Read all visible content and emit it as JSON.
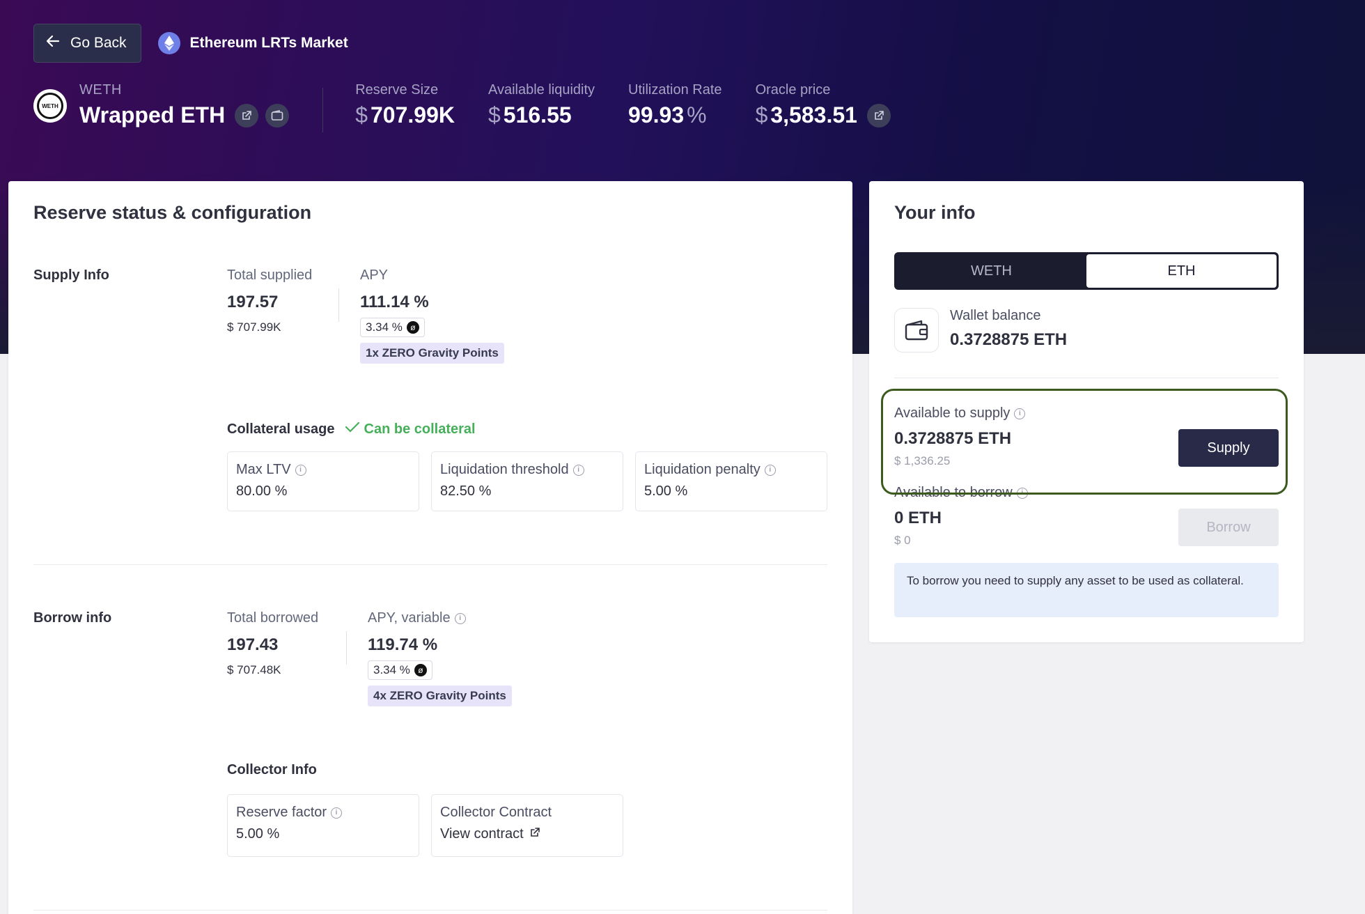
{
  "header": {
    "back_label": "Go Back",
    "market_name": "Ethereum LRTs Market",
    "asset_logo_text": "WETH",
    "asset_symbol": "WETH",
    "asset_name": "Wrapped ETH",
    "stats": [
      {
        "label": "Reserve Size",
        "prefix": "$",
        "value": "707.99K",
        "suffix": ""
      },
      {
        "label": "Available liquidity",
        "prefix": "$",
        "value": "516.55",
        "suffix": ""
      },
      {
        "label": "Utilization Rate",
        "prefix": "",
        "value": "99.93",
        "suffix": "%"
      },
      {
        "label": "Oracle price",
        "prefix": "$",
        "value": "3,583.51",
        "suffix": ""
      }
    ]
  },
  "reserve": {
    "title": "Reserve status & configuration",
    "supply": {
      "section_label": "Supply Info",
      "total_label": "Total supplied",
      "total_value": "197.57",
      "total_usd": "$ 707.99K",
      "apy_label": "APY",
      "apy_value": "111.14 %",
      "apy_chip": "3.34 %",
      "points": "1x ZERO Gravity Points"
    },
    "collateral": {
      "label": "Collateral usage",
      "status": "Can be collateral",
      "boxes": [
        {
          "label": "Max LTV",
          "value": "80.00 %"
        },
        {
          "label": "Liquidation threshold",
          "value": "82.50 %"
        },
        {
          "label": "Liquidation penalty",
          "value": "5.00 %"
        }
      ]
    },
    "borrow": {
      "section_label": "Borrow info",
      "total_label": "Total borrowed",
      "total_value": "197.43",
      "total_usd": "$ 707.48K",
      "apy_label": "APY, variable",
      "apy_value": "119.74 %",
      "apy_chip": "3.34 %",
      "points": "4x ZERO Gravity Points"
    },
    "collector": {
      "label": "Collector Info",
      "reserve_factor_label": "Reserve factor",
      "reserve_factor_value": "5.00 %",
      "contract_label": "Collector Contract",
      "contract_link": "View contract"
    }
  },
  "your_info": {
    "title": "Your info",
    "tabs": [
      {
        "label": "WETH",
        "active": false
      },
      {
        "label": "ETH",
        "active": true
      }
    ],
    "wallet_label": "Wallet balance",
    "wallet_value": "0.3728875 ETH",
    "supply_label": "Available to supply",
    "supply_value": "0.3728875 ETH",
    "supply_usd": "$ 1,336.25",
    "supply_button": "Supply",
    "borrow_label": "Available to borrow",
    "borrow_value": "0 ETH",
    "borrow_usd": "$ 0",
    "borrow_button": "Borrow",
    "notice": "To borrow you need to supply any asset to be used as collateral."
  },
  "colors": {
    "accent_dark": "#292a47",
    "collateral_green": "#46af5a",
    "highlight_border": "#3d5a1e",
    "points_bg": "#e7e3f9"
  }
}
